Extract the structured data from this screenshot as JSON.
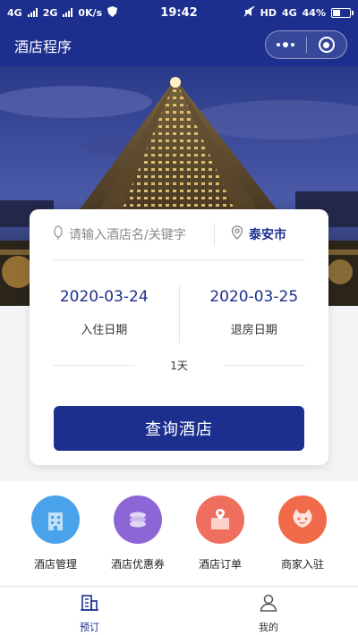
{
  "status_bar": {
    "network_left": "4G",
    "network_left2": "2G",
    "speed": "0K/s",
    "time": "19:42",
    "hd": "HD",
    "network_right": "4G",
    "battery": "44%",
    "battery_level": 0.44
  },
  "navbar": {
    "title": "酒店程序"
  },
  "search": {
    "placeholder": "请输入酒店名/关键字",
    "city": "泰安市"
  },
  "dates": {
    "checkin_date": "2020-03-24",
    "checkin_label": "入住日期",
    "checkout_date": "2020-03-25",
    "checkout_label": "退房日期",
    "nights": "1天"
  },
  "query_button": "查询酒店",
  "menu": {
    "items": [
      {
        "label": "酒店管理",
        "icon": "hotel-building-icon",
        "color": "#4aa3ea"
      },
      {
        "label": "酒店优惠券",
        "icon": "coins-icon",
        "color": "#8d66d6"
      },
      {
        "label": "酒店订单",
        "icon": "order-location-icon",
        "color": "#ef6f5f"
      },
      {
        "label": "商家入驻",
        "icon": "cat-icon",
        "color": "#f16a4a"
      }
    ]
  },
  "tabbar": {
    "tabs": [
      {
        "label": "预订",
        "icon": "building-icon",
        "active": true
      },
      {
        "label": "我的",
        "icon": "user-icon",
        "active": false
      }
    ]
  },
  "colors": {
    "primary": "#1c2f8e",
    "background": "#f4f4f6"
  }
}
